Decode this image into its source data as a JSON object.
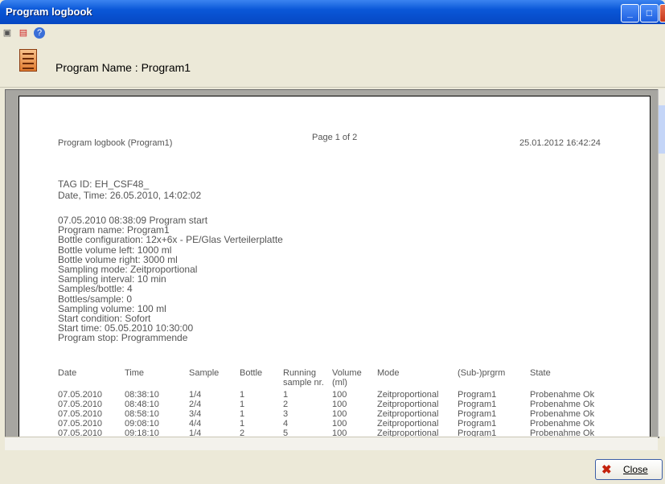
{
  "window": {
    "title": "Program logbook"
  },
  "toolbar": {
    "icons": [
      "print-icon",
      "pdf-icon",
      "help-icon"
    ]
  },
  "header": {
    "program_label": "Program Name : Program1"
  },
  "report": {
    "page_indicator": "Page 1 of 2",
    "report_title": "Program logbook (Program1)",
    "report_timestamp": "25.01.2012 16:42:24",
    "tag_id": "TAG ID: EH_CSF48_",
    "date_time": "Date, Time: 26.05.2010, 14:02:02",
    "info_lines": [
      "07.05.2010 08:38:09 Program start",
      "Program name: Program1",
      "Bottle configuration: 12x+6x - PE/Glas Verteilerplatte",
      "Bottle volume left: 1000 ml",
      "Bottle volume right: 3000 ml",
      "Sampling mode: Zeitproportional",
      "Sampling interval: 10 min",
      "Samples/bottle: 4",
      "Bottles/sample: 0",
      "Sampling volume: 100 ml",
      "Start condition: Sofort",
      "Start time: 05.05.2010 10:30:00",
      "Program stop: Programmende"
    ],
    "table": {
      "headers": [
        "Date",
        "Time",
        "Sample",
        "Bottle",
        "Running sample nr.",
        "Volume (ml)",
        "Mode",
        "(Sub-)prgrm",
        "State"
      ],
      "header_line1": [
        "Date",
        "Time",
        "Sample",
        "Bottle",
        "Running",
        "Volume",
        "Mode",
        "(Sub-)prgrm",
        "State"
      ],
      "header_line2": [
        "",
        "",
        "",
        "",
        "sample nr.",
        "(ml)",
        "",
        "",
        ""
      ],
      "rows": [
        [
          "07.05.2010",
          "08:38:10",
          "1/4",
          "1",
          "1",
          "100",
          "Zeitproportional",
          "Program1",
          "Probenahme Ok"
        ],
        [
          "07.05.2010",
          "08:48:10",
          "2/4",
          "1",
          "2",
          "100",
          "Zeitproportional",
          "Program1",
          "Probenahme Ok"
        ],
        [
          "07.05.2010",
          "08:58:10",
          "3/4",
          "1",
          "3",
          "100",
          "Zeitproportional",
          "Program1",
          "Probenahme Ok"
        ],
        [
          "07.05.2010",
          "09:08:10",
          "4/4",
          "1",
          "4",
          "100",
          "Zeitproportional",
          "Program1",
          "Probenahme Ok"
        ],
        [
          "07.05.2010",
          "09:18:10",
          "1/4",
          "2",
          "5",
          "100",
          "Zeitproportional",
          "Program1",
          "Probenahme Ok"
        ]
      ]
    }
  },
  "footer": {
    "close_label": "Close"
  }
}
